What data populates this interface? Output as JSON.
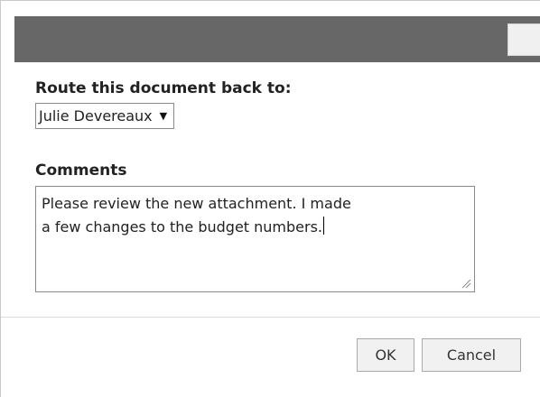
{
  "dialog": {
    "title": "",
    "route_label": "Route this document back to:",
    "route_select": {
      "selected": "Julie Devereaux",
      "arrow": "▼"
    },
    "comments_label": "Comments",
    "comments_value_line1": "Please review the new attachment. I made",
    "comments_value_line2": "a few changes to the budget numbers.",
    "buttons": {
      "ok": "OK",
      "cancel": "Cancel"
    }
  },
  "colors": {
    "titlebar": "#676767",
    "border": "#8a8a8a",
    "button_bg": "#f1f1f1"
  }
}
